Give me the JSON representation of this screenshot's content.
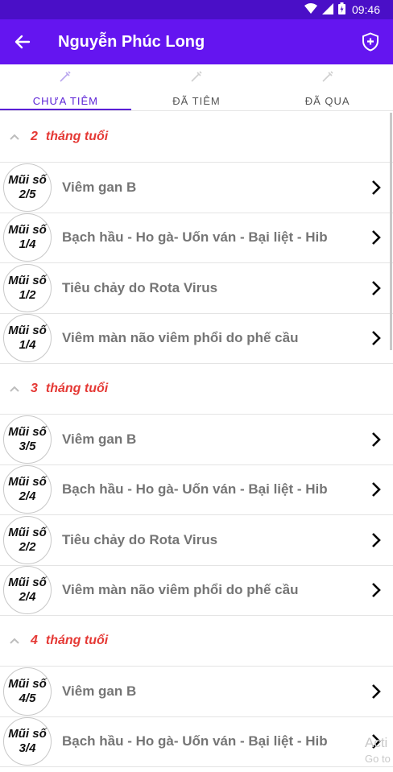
{
  "status_bar": {
    "time": "09:46"
  },
  "app_bar": {
    "title": "Nguyễn Phúc Long"
  },
  "tabs": [
    {
      "label": "CHƯA TIÊM",
      "active": true
    },
    {
      "label": "ĐÃ TIÊM",
      "active": false
    },
    {
      "label": "ĐÃ QUA",
      "active": false
    }
  ],
  "sections": [
    {
      "age_number": "2",
      "age_unit": "tháng tuổi",
      "rows": [
        {
          "dose_label": "Mũi số",
          "dose": "2/5",
          "name": "Viêm gan B"
        },
        {
          "dose_label": "Mũi số",
          "dose": "1/4",
          "name": "Bạch hầu - Ho gà- Uốn ván - Bại liệt - Hib"
        },
        {
          "dose_label": "Mũi số",
          "dose": "1/2",
          "name": "Tiêu chảy do Rota Virus"
        },
        {
          "dose_label": "Mũi số",
          "dose": "1/4",
          "name": "Viêm màn não viêm phổi do phế cầu"
        }
      ]
    },
    {
      "age_number": "3",
      "age_unit": "tháng tuổi",
      "rows": [
        {
          "dose_label": "Mũi số",
          "dose": "3/5",
          "name": "Viêm gan B"
        },
        {
          "dose_label": "Mũi số",
          "dose": "2/4",
          "name": "Bạch hầu - Ho gà- Uốn ván - Bại liệt - Hib"
        },
        {
          "dose_label": "Mũi số",
          "dose": "2/2",
          "name": "Tiêu chảy do Rota Virus"
        },
        {
          "dose_label": "Mũi số",
          "dose": "2/4",
          "name": "Viêm màn não viêm phổi do phế cầu"
        }
      ]
    },
    {
      "age_number": "4",
      "age_unit": "tháng tuổi",
      "rows": [
        {
          "dose_label": "Mũi số",
          "dose": "4/5",
          "name": "Viêm gan B"
        },
        {
          "dose_label": "Mũi số",
          "dose": "3/4",
          "name": "Bạch hầu - Ho gà- Uốn ván - Bại liệt - Hib"
        }
      ]
    }
  ],
  "watermark": {
    "line1": "Acti",
    "line2": "Go to"
  },
  "colors": {
    "status_bar": "#4a0fc7",
    "app_bar": "#6415f0",
    "accent": "#5a1fd6",
    "age_text": "#e53935"
  }
}
